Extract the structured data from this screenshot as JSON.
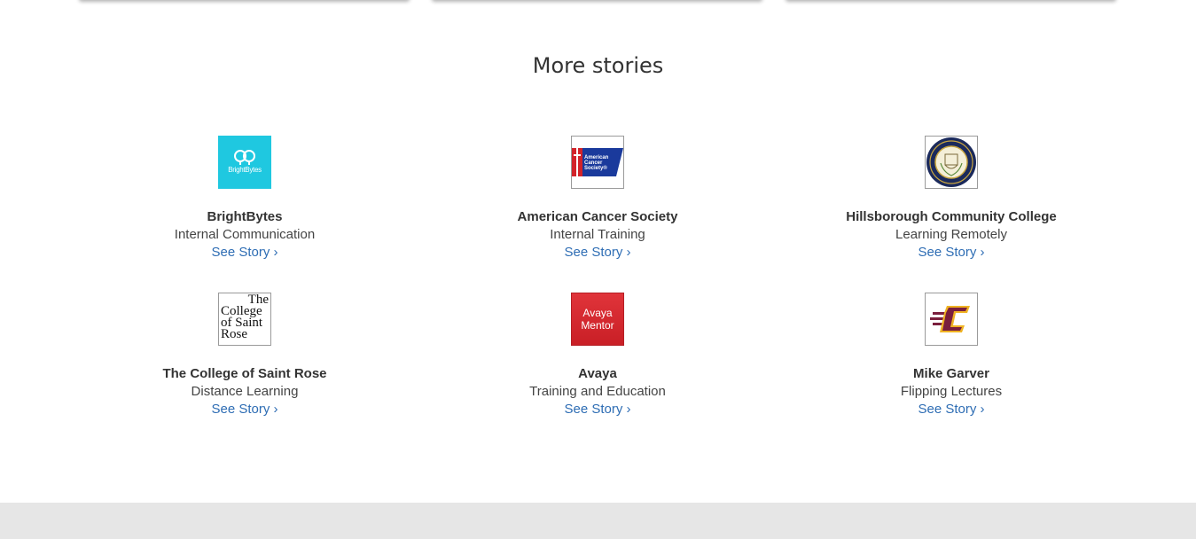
{
  "section": {
    "title": "More stories"
  },
  "logos": {
    "brightbytes_text": "BrightBytes",
    "acs_text_line1": "American",
    "acs_text_line2": "Cancer",
    "acs_text_line3": "Society®",
    "rose_text_line1": "The",
    "rose_text_line2": "College",
    "rose_text_line3": "of Saint",
    "rose_text_line4": "Rose",
    "avaya_text_line1": "Avaya",
    "avaya_text_line2": "Mentor"
  },
  "stories": [
    {
      "name": "BrightBytes",
      "subtitle": "Internal Communication",
      "link": "See Story ›"
    },
    {
      "name": "American Cancer Society",
      "subtitle": "Internal Training",
      "link": "See Story ›"
    },
    {
      "name": "Hillsborough Community College",
      "subtitle": "Learning Remotely",
      "link": "See Story ›"
    },
    {
      "name": "The College of Saint Rose",
      "subtitle": "Distance Learning",
      "link": "See Story ›"
    },
    {
      "name": "Avaya",
      "subtitle": "Training and Education",
      "link": "See Story ›"
    },
    {
      "name": "Mike Garver",
      "subtitle": "Flipping Lectures",
      "link": "See Story ›"
    }
  ],
  "colors": {
    "link": "#2e6db4",
    "brightbytes": "#1fc8e0",
    "acs_blue": "#1a3a9c",
    "acs_red": "#d2232a",
    "avaya_red": "#d2232a",
    "cmu_maroon": "#7a1f3d",
    "cmu_gold": "#f0b323",
    "footer": "#e6e6e6"
  }
}
